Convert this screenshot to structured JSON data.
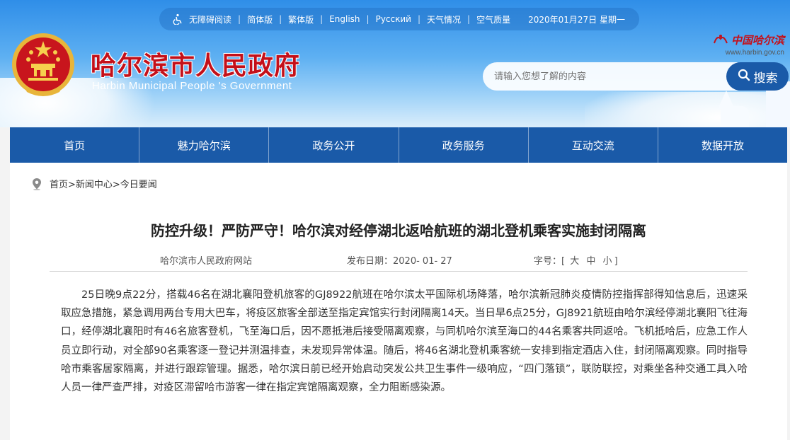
{
  "topbar": {
    "items": [
      "无障碍阅读",
      "简体版",
      "繁体版",
      "English",
      "Русский",
      "天气情况",
      "空气质量"
    ],
    "date": "2020年01月27日 星期一"
  },
  "site": {
    "title_cn": "哈尔滨市人民政府",
    "title_en": "Harbin Municipal People 's Government",
    "brand_cn": "中国哈尔滨",
    "brand_url": "www.harbin.gov.cn"
  },
  "search": {
    "placeholder": "请输入您想了解的内容",
    "button_label": "搜索"
  },
  "nav": {
    "items": [
      "首页",
      "魅力哈尔滨",
      "政务公开",
      "政务服务",
      "互动交流",
      "数据开放"
    ]
  },
  "breadcrumb": "首页>新闻中心>今日要闻",
  "article": {
    "title": "防控升级！严防严守！哈尔滨对经停湖北返哈航班的湖北登机乘客实施封闭隔离",
    "source": "哈尔滨市人民政府网站",
    "date_label": "发布日期：",
    "date": "2020- 01- 27",
    "size_label": "字号：",
    "size_open": "[",
    "size_large": "大",
    "size_medium": "中",
    "size_small": "小",
    "size_close": "]",
    "body": "25日晚9点22分，搭载46名在湖北襄阳登机旅客的GJ8922航班在哈尔滨太平国际机场降落，哈尔滨新冠肺炎疫情防控指挥部得知信息后，迅速采取应急措施，紧急调用两台专用大巴车，将疫区旅客全部送至指定宾馆实行封闭隔离14天。当日早6点25分，GJ8921航班由哈尔滨经停湖北襄阳飞往海口，经停湖北襄阳时有46名旅客登机，飞至海口后，因不愿抵港后接受隔离观察，与同机哈尔滨至海口的44名乘客共同返哈。飞机抵哈后，应急工作人员立即行动，对全部90名乘客逐一登记并测温排查，未发现异常体温。随后，将46名湖北登机乘客统一安排到指定酒店入住，封闭隔离观察。同时指导哈市乘客居家隔离，并进行跟踪管理。据悉，哈尔滨日前已经开始启动突发公共卫生事件一级响应，“四门落锁”，联防联控，对乘坐各种交通工具入哈人员一律严查严排，对疫区滞留哈市游客一律在指定宾馆隔离观察，全力阻断感染源。"
  },
  "colors": {
    "nav_bg": "#1a5aa8",
    "title_red": "#c4101a",
    "header_sky": "#5eb0f2"
  }
}
